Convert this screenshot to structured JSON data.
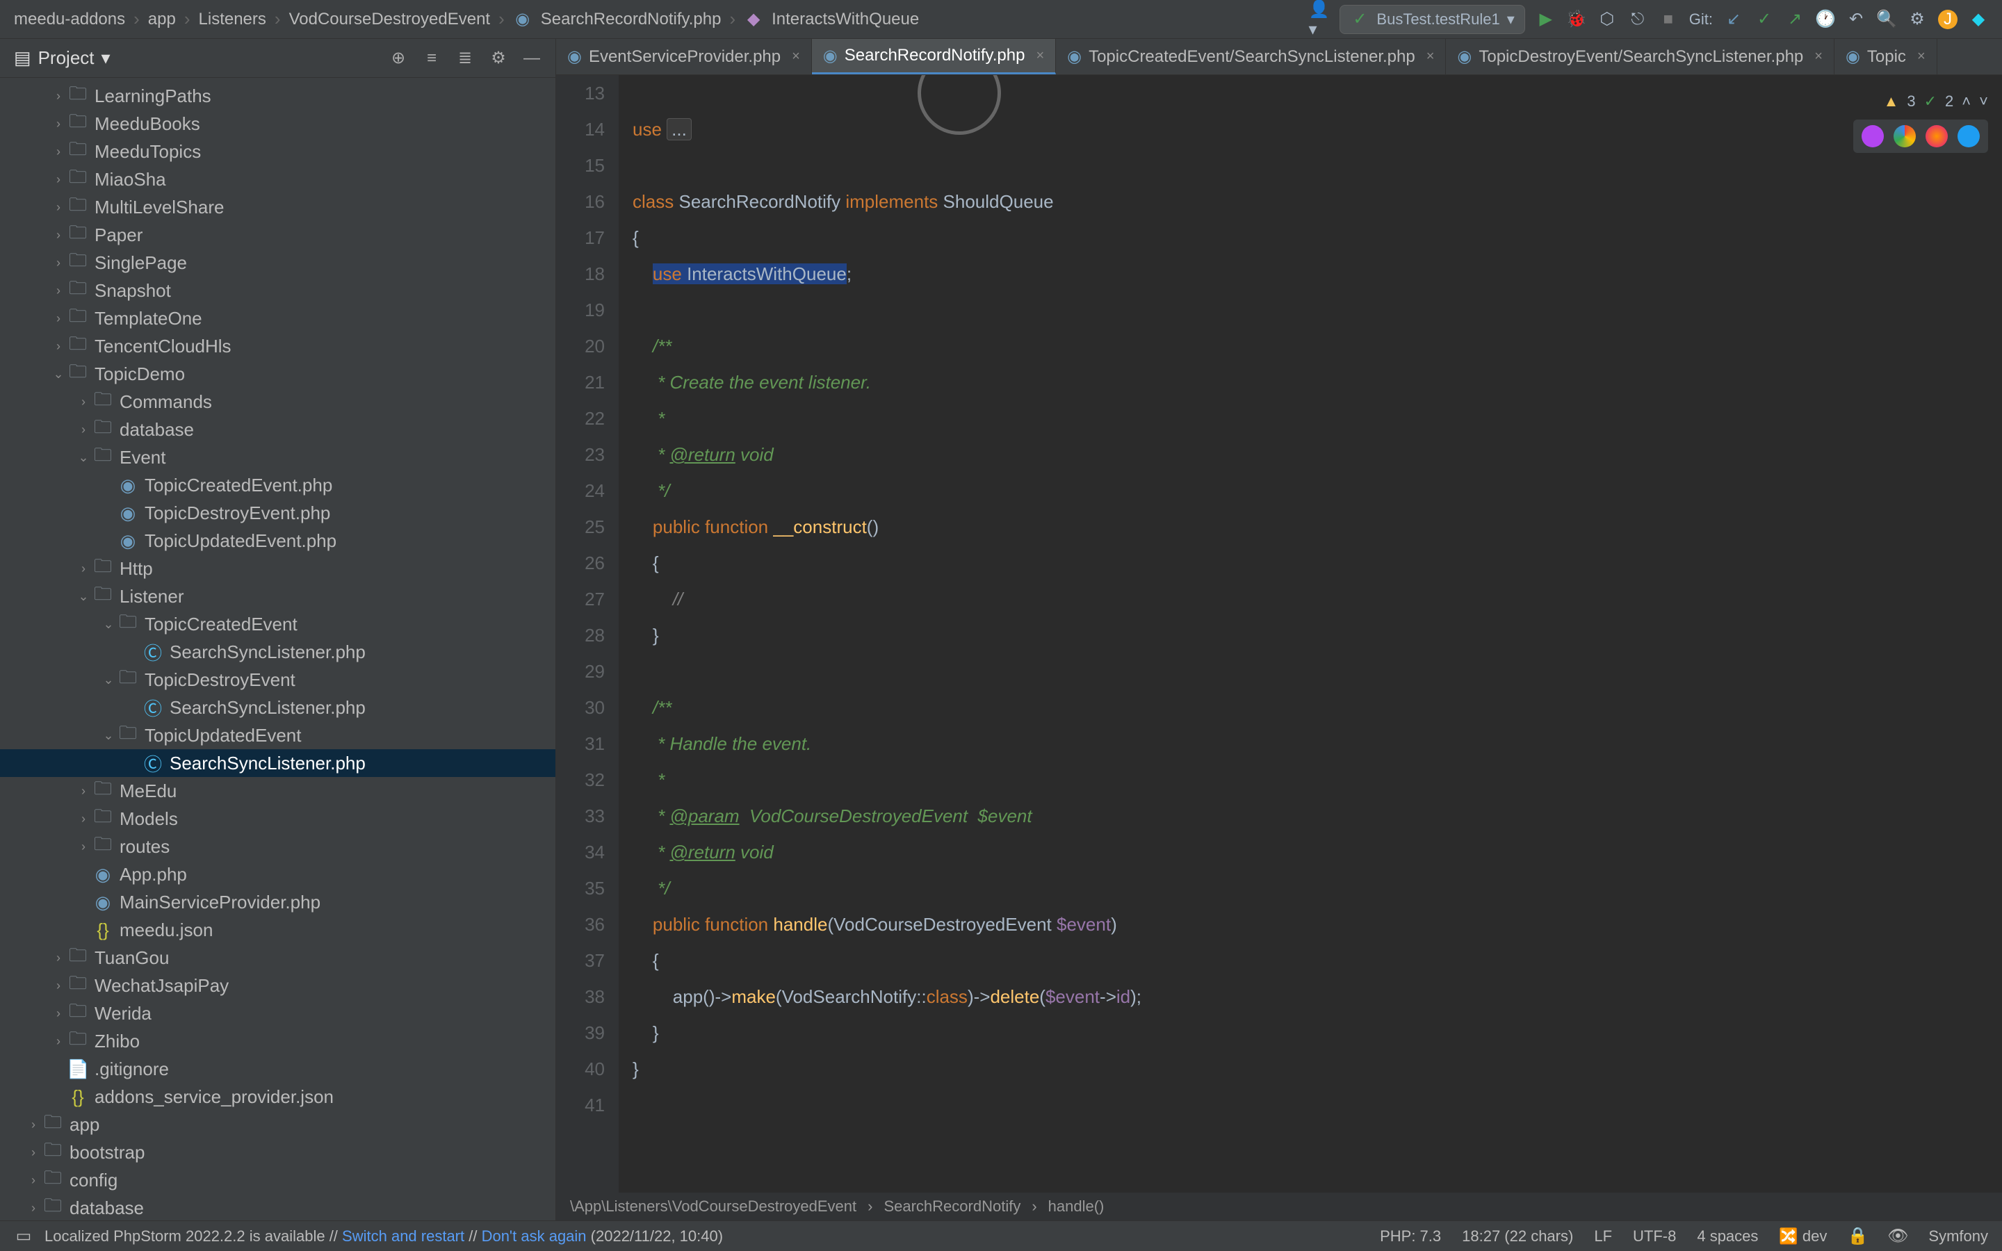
{
  "breadcrumbs": [
    "meedu-addons",
    "app",
    "Listeners",
    "VodCourseDestroyedEvent",
    "SearchRecordNotify.php",
    "InteractsWithQueue"
  ],
  "run_config": "BusTest.testRule1",
  "git_label": "Git:",
  "project": {
    "title": "Project"
  },
  "tree": [
    {
      "d": 2,
      "a": ">",
      "i": "folder",
      "t": "LearningPaths"
    },
    {
      "d": 2,
      "a": ">",
      "i": "folder",
      "t": "MeeduBooks"
    },
    {
      "d": 2,
      "a": ">",
      "i": "folder",
      "t": "MeeduTopics"
    },
    {
      "d": 2,
      "a": ">",
      "i": "folder",
      "t": "MiaoSha"
    },
    {
      "d": 2,
      "a": ">",
      "i": "folder",
      "t": "MultiLevelShare"
    },
    {
      "d": 2,
      "a": ">",
      "i": "folder",
      "t": "Paper"
    },
    {
      "d": 2,
      "a": ">",
      "i": "folder",
      "t": "SinglePage"
    },
    {
      "d": 2,
      "a": ">",
      "i": "folder",
      "t": "Snapshot"
    },
    {
      "d": 2,
      "a": ">",
      "i": "folder",
      "t": "TemplateOne"
    },
    {
      "d": 2,
      "a": ">",
      "i": "folder",
      "t": "TencentCloudHls"
    },
    {
      "d": 2,
      "a": "v",
      "i": "folder",
      "t": "TopicDemo"
    },
    {
      "d": 3,
      "a": ">",
      "i": "folder",
      "t": "Commands"
    },
    {
      "d": 3,
      "a": ">",
      "i": "folder",
      "t": "database"
    },
    {
      "d": 3,
      "a": "v",
      "i": "folder",
      "t": "Event"
    },
    {
      "d": 4,
      "a": "",
      "i": "php",
      "t": "TopicCreatedEvent.php"
    },
    {
      "d": 4,
      "a": "",
      "i": "php",
      "t": "TopicDestroyEvent.php"
    },
    {
      "d": 4,
      "a": "",
      "i": "php",
      "t": "TopicUpdatedEvent.php"
    },
    {
      "d": 3,
      "a": ">",
      "i": "folder",
      "t": "Http"
    },
    {
      "d": 3,
      "a": "v",
      "i": "folder",
      "t": "Listener"
    },
    {
      "d": 4,
      "a": "v",
      "i": "folder",
      "t": "TopicCreatedEvent"
    },
    {
      "d": 5,
      "a": "",
      "i": "class",
      "t": "SearchSyncListener.php"
    },
    {
      "d": 4,
      "a": "v",
      "i": "folder",
      "t": "TopicDestroyEvent"
    },
    {
      "d": 5,
      "a": "",
      "i": "class",
      "t": "SearchSyncListener.php"
    },
    {
      "d": 4,
      "a": "v",
      "i": "folder",
      "t": "TopicUpdatedEvent"
    },
    {
      "d": 5,
      "a": "",
      "i": "class",
      "t": "SearchSyncListener.php",
      "sel": true
    },
    {
      "d": 3,
      "a": ">",
      "i": "folder",
      "t": "MeEdu"
    },
    {
      "d": 3,
      "a": ">",
      "i": "folder",
      "t": "Models"
    },
    {
      "d": 3,
      "a": ">",
      "i": "folder",
      "t": "routes"
    },
    {
      "d": 3,
      "a": "",
      "i": "php",
      "t": "App.php"
    },
    {
      "d": 3,
      "a": "",
      "i": "php",
      "t": "MainServiceProvider.php"
    },
    {
      "d": 3,
      "a": "",
      "i": "json",
      "t": "meedu.json"
    },
    {
      "d": 2,
      "a": ">",
      "i": "folder",
      "t": "TuanGou"
    },
    {
      "d": 2,
      "a": ">",
      "i": "folder",
      "t": "WechatJsapiPay"
    },
    {
      "d": 2,
      "a": ">",
      "i": "folder",
      "t": "Werida"
    },
    {
      "d": 2,
      "a": ">",
      "i": "folder",
      "t": "Zhibo"
    },
    {
      "d": 2,
      "a": "",
      "i": "file",
      "t": ".gitignore"
    },
    {
      "d": 2,
      "a": "",
      "i": "json",
      "t": "addons_service_provider.json"
    },
    {
      "d": 1,
      "a": ">",
      "i": "folder",
      "t": "app"
    },
    {
      "d": 1,
      "a": ">",
      "i": "folder",
      "t": "bootstrap"
    },
    {
      "d": 1,
      "a": ">",
      "i": "folder",
      "t": "config"
    },
    {
      "d": 1,
      "a": ">",
      "i": "folder",
      "t": "database"
    }
  ],
  "tabs": [
    {
      "label": "EventServiceProvider.php",
      "icon": "php"
    },
    {
      "label": "SearchRecordNotify.php",
      "icon": "php",
      "active": true
    },
    {
      "label": "TopicCreatedEvent/SearchSyncListener.php",
      "icon": "php"
    },
    {
      "label": "TopicDestroyEvent/SearchSyncListener.php",
      "icon": "php"
    },
    {
      "label": "Topic",
      "icon": "php"
    }
  ],
  "inspections": {
    "warnings": "3",
    "weak": "2"
  },
  "gutter_start": 13,
  "gutter_end": 41,
  "editor_breadcrumb": [
    "\\App\\Listeners\\VodCourseDestroyedEvent",
    "SearchRecordNotify",
    "handle()"
  ],
  "code": {
    "l13": "",
    "l14_use": "use",
    "l14_fold": "...",
    "l15": "",
    "l16_class": "class",
    "l16_name": "SearchRecordNotify",
    "l16_impl": "implements",
    "l16_iface": "ShouldQueue",
    "l17": "{",
    "l18_use": "use",
    "l18_trait": "InteractsWithQueue",
    "l18_semi": ";",
    "l19": "",
    "l20": "    /**",
    "l21": "     * Create the event listener.",
    "l22": "     *",
    "l23_a": "     * ",
    "l23_tag": "@return",
    "l23_b": " void",
    "l24": "     */",
    "l25_pub": "public",
    "l25_fn": "function",
    "l25_name": "__construct",
    "l25_p": "()",
    "l26": "    {",
    "l27": "        //",
    "l28": "    }",
    "l29": "",
    "l30": "    /**",
    "l31": "     * Handle the event.",
    "l32": "     *",
    "l33_a": "     * ",
    "l33_tag": "@param",
    "l33_b": "  VodCourseDestroyedEvent  $event",
    "l34_a": "     * ",
    "l34_tag": "@return",
    "l34_b": " void",
    "l35": "     */",
    "l36_pub": "public",
    "l36_fn": "function",
    "l36_name": "handle",
    "l36_p1": "(VodCourseDestroyedEvent ",
    "l36_var": "$event",
    "l36_p2": ")",
    "l37": "    {",
    "l38_a": "        app()->",
    "l38_make": "make",
    "l38_b": "(VodSearchNotify::",
    "l38_class": "class",
    "l38_c": ")->",
    "l38_del": "delete",
    "l38_d": "(",
    "l38_var": "$event",
    "l38_e": "->",
    "l38_id": "id",
    "l38_f": ");",
    "l39": "    }",
    "l40": "}",
    "l41": ""
  },
  "status": {
    "left_a": "Localized PhpStorm 2022.2.2 is available // ",
    "left_link1": "Switch and restart",
    "left_b": " // ",
    "left_link2": "Don't ask again",
    "left_c": " (2022/11/22, 10:40)",
    "php": "PHP: 7.3",
    "pos": "18:27 (22 chars)",
    "le": "LF",
    "enc": "UTF-8",
    "indent": "4 spaces",
    "branch": "dev",
    "fw": "Symfony"
  }
}
